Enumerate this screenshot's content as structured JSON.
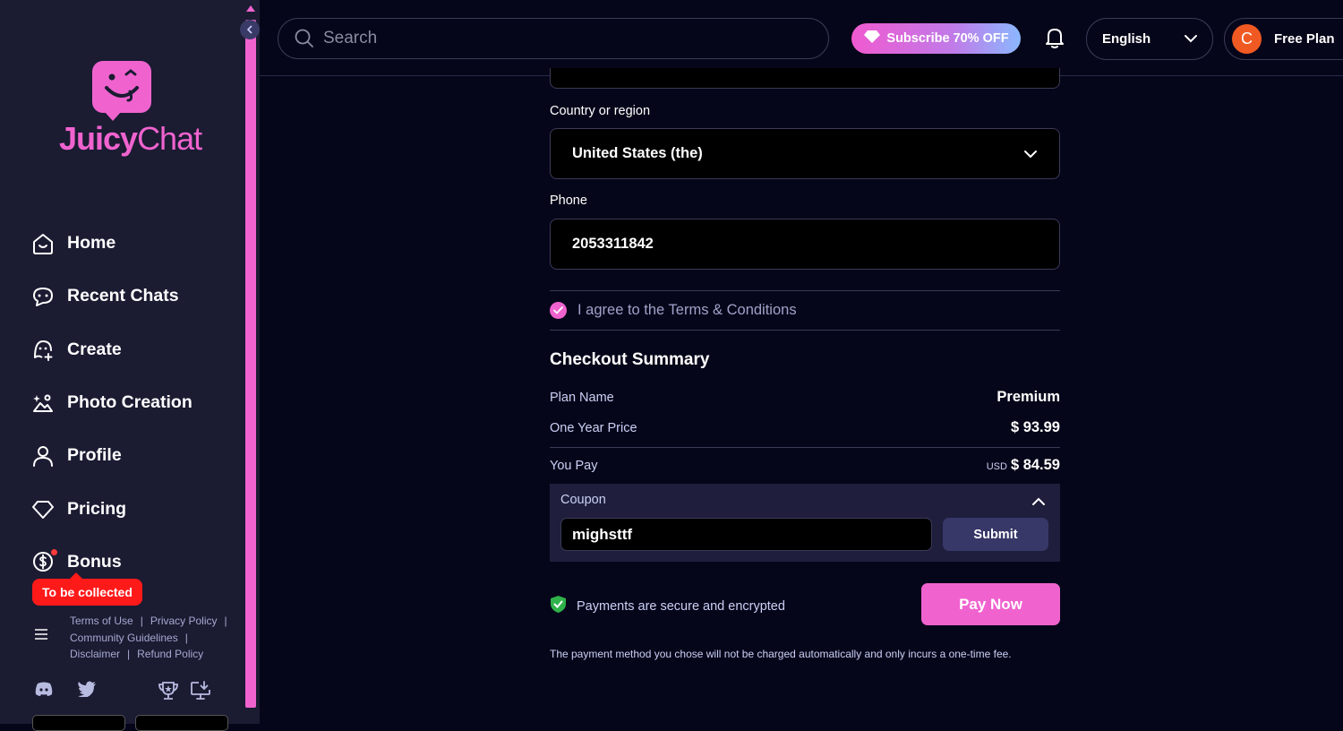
{
  "brand": {
    "name_part1": "Juicy",
    "name_part2": "Chat"
  },
  "sidebar": {
    "items": [
      {
        "label": "Home",
        "icon": "home-icon"
      },
      {
        "label": "Recent Chats",
        "icon": "chat-bubble-icon"
      },
      {
        "label": "Create",
        "icon": "create-character-icon"
      },
      {
        "label": "Photo Creation",
        "icon": "photo-icon"
      },
      {
        "label": "Profile",
        "icon": "user-icon"
      },
      {
        "label": "Pricing",
        "icon": "diamond-icon"
      },
      {
        "label": "Bonus",
        "icon": "dollar-coin-icon"
      }
    ],
    "bonus_badge": "To be collected",
    "footer_links": {
      "terms": "Terms of Use",
      "privacy": "Privacy Policy",
      "community": "Community Guidelines",
      "disclaimer": "Disclaimer",
      "refund": "Refund Policy",
      "separator": "|"
    },
    "socials": [
      "discord-icon",
      "twitter-icon",
      "trophy-icon",
      "download-icon"
    ]
  },
  "topbar": {
    "search_placeholder": "Search",
    "subscribe_label": "Subscribe 70% OFF",
    "language": "English",
    "avatar_letter": "C",
    "plan": "Free Plan"
  },
  "form": {
    "country_label": "Country or region",
    "country_value": "United States (the)",
    "phone_label": "Phone",
    "phone_value": "2053311842",
    "agree_text": "I agree to the Terms & Conditions",
    "agree_checked": true
  },
  "summary": {
    "title": "Checkout Summary",
    "plan_name_label": "Plan Name",
    "plan_name_value": "Premium",
    "year_price_label": "One Year Price",
    "year_price_value": "$ 93.99",
    "you_pay_label": "You Pay",
    "you_pay_currency": "USD",
    "you_pay_value": "$ 84.59"
  },
  "coupon": {
    "label": "Coupon",
    "value": "mighsttf",
    "submit_label": "Submit"
  },
  "payment": {
    "secure_text": "Payments are secure and encrypted",
    "pay_label": "Pay Now",
    "note": "The payment method you chose will not be charged automatically and only incurs a one-time fee."
  },
  "colors": {
    "accent": "#f063cf",
    "background": "#06061a",
    "sidebar": "#1b1b32",
    "alert": "#ff1a1a",
    "secure_green": "#2fb24a"
  }
}
